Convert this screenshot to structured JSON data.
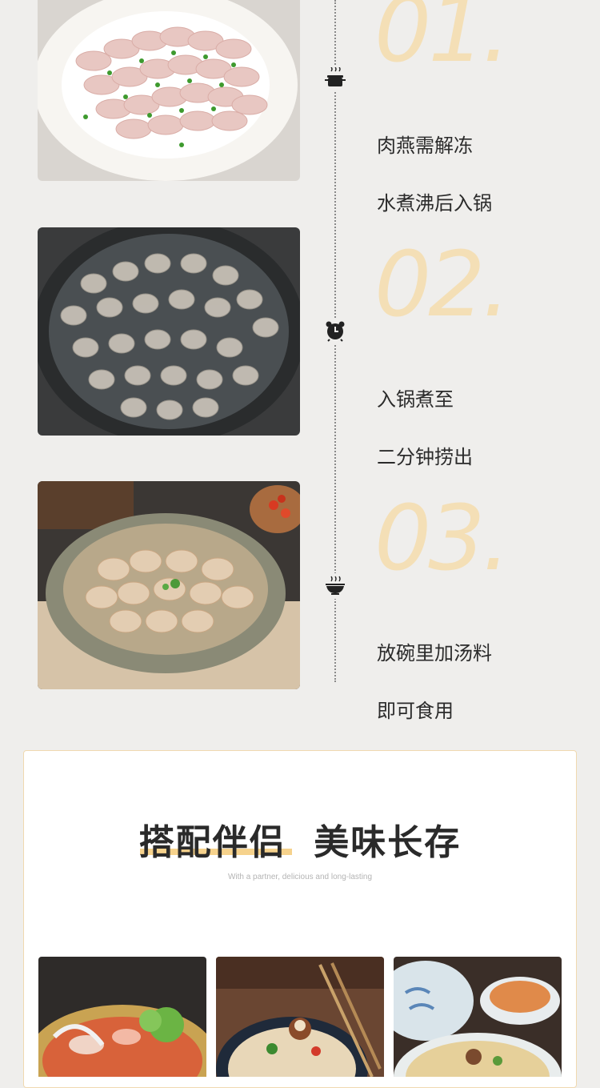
{
  "steps": [
    {
      "number": "01.",
      "line1": "肉燕需解冻",
      "line2": "水煮沸后入锅",
      "icon": "pot-icon"
    },
    {
      "number": "02.",
      "line1": "入锅煮至",
      "line2": "二分钟捞出",
      "icon": "alarm-clock-icon"
    },
    {
      "number": "03.",
      "line1": "放碗里加汤料",
      "line2": "即可食用",
      "icon": "steaming-bowl-icon"
    }
  ],
  "pairing": {
    "title": "搭配伴侣  美味长存",
    "subtitle": "With a partner, delicious and long-lasting"
  },
  "colors": {
    "background": "#efeeec",
    "accent": "#f4dfb6",
    "underline": "#f6d28c",
    "text": "#2b2b2b"
  }
}
